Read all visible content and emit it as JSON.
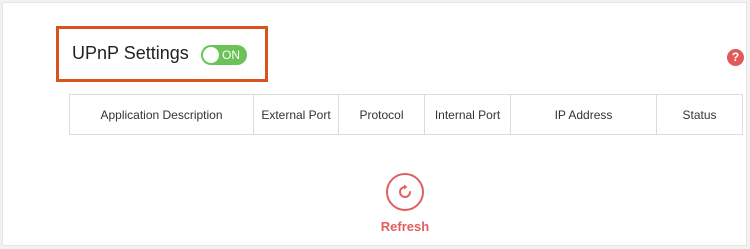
{
  "header": {
    "title": "UPnP Settings",
    "toggle_label": "ON",
    "toggle_state": "on",
    "help_symbol": "?",
    "help_icon": "question-circle-icon"
  },
  "table": {
    "columns": [
      "Application Description",
      "External Port",
      "Protocol",
      "Internal Port",
      "IP Address",
      "Status"
    ],
    "rows": []
  },
  "refresh": {
    "label": "Refresh",
    "icon": "refresh-icon"
  },
  "colors": {
    "highlight": "#d9531e",
    "toggle_on": "#6ac259",
    "accent": "#e06060"
  }
}
